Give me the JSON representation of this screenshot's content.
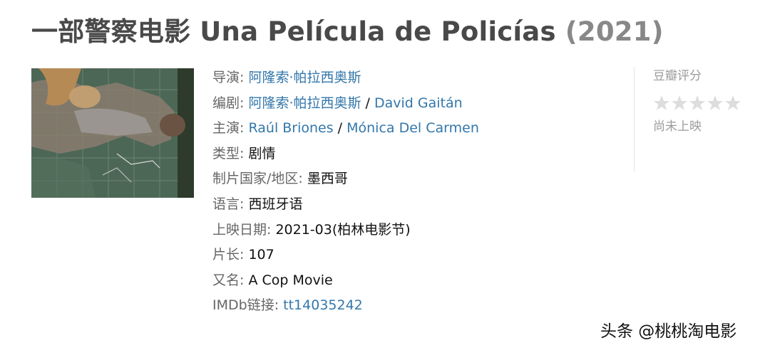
{
  "title": {
    "main": "一部警察电影 Una Película de Policías",
    "year": "(2021)"
  },
  "info": {
    "director_label": "导演",
    "director": "阿隆索·帕拉西奥斯",
    "writer_label": "编剧",
    "writer_1": "阿隆索·帕拉西奥斯",
    "writer_sep": " / ",
    "writer_2": "David Gaitán",
    "cast_label": "主演",
    "cast_1": "Raúl Briones",
    "cast_sep": " / ",
    "cast_2": "Mónica Del Carmen",
    "genre_label": "类型",
    "genre": "剧情",
    "country_label": "制片国家/地区",
    "country": "墨西哥",
    "language_label": "语言",
    "language": "西班牙语",
    "release_label": "上映日期",
    "release": "2021-03(柏林电影节)",
    "runtime_label": "片长",
    "runtime": "107",
    "aka_label": "又名",
    "aka": "A Cop Movie",
    "imdb_label": "IMDb链接",
    "imdb": "tt14035242",
    "colon": ": "
  },
  "rating": {
    "title": "豆瓣评分",
    "status": "尚未上映",
    "stars": 0,
    "max_stars": 5,
    "icon": "star-icon"
  },
  "watermark": "头条 @桃桃淘电影",
  "colors": {
    "link": "#3377aa",
    "title": "#494949",
    "label": "#666666",
    "muted": "#9b9b9b",
    "star_empty": "#dddddd"
  }
}
